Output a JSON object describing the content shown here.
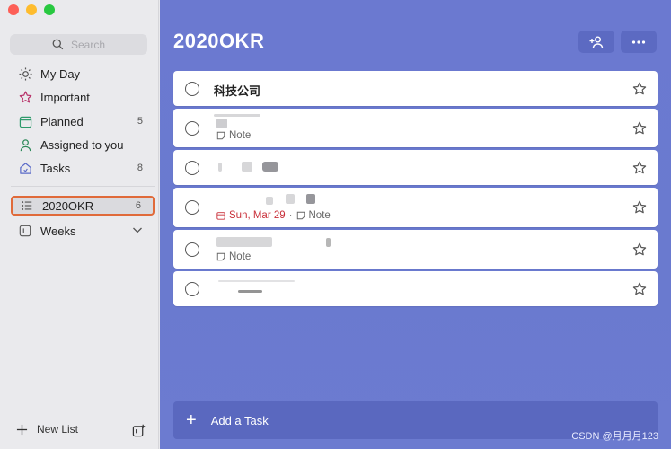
{
  "sidebar": {
    "search_placeholder": "Search",
    "items": [
      {
        "label": "My Day",
        "count": ""
      },
      {
        "label": "Important",
        "count": ""
      },
      {
        "label": "Planned",
        "count": "5"
      },
      {
        "label": "Assigned to you",
        "count": ""
      },
      {
        "label": "Tasks",
        "count": "8"
      }
    ],
    "lists": [
      {
        "label": "2020OKR",
        "count": "6",
        "selected": true
      },
      {
        "label": "Weeks",
        "count": ""
      }
    ],
    "new_list_label": "New List"
  },
  "main": {
    "title": "2020OKR",
    "tasks": [
      {
        "text": "科技公司",
        "note": "",
        "due": ""
      },
      {
        "text": "",
        "note": "Note",
        "due": ""
      },
      {
        "text": "",
        "note": "",
        "due": ""
      },
      {
        "text": "",
        "note": "Note",
        "due": "Sun, Mar 29"
      },
      {
        "text": "",
        "note": "Note",
        "due": ""
      },
      {
        "text": "",
        "note": "",
        "due": ""
      }
    ],
    "add_task_label": "Add a Task"
  },
  "watermark": "CSDN @月月月123",
  "colors": {
    "accent": "#6b79d0",
    "selection_border": "#e06a3a",
    "due_color": "#c9303a"
  }
}
